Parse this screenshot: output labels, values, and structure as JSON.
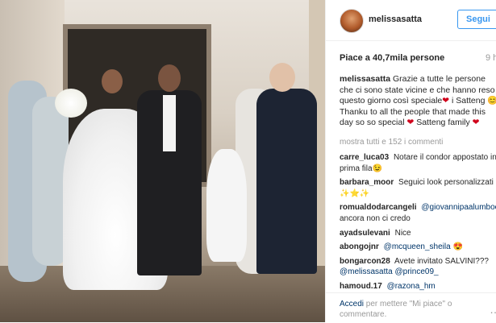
{
  "post": {
    "username": "melissasatta",
    "follow_label": "Segui",
    "likes": "Piace a 40,7mila persone",
    "time": "9 h",
    "caption_user": "melissasatta",
    "caption_text_1": "Grazie a tutte le persone che ci sono state vicine e che hanno reso questo giorno così speciale",
    "caption_text_2": "i Satteng",
    "caption_text_3": "Thanku to all the people that made this day so so special",
    "caption_text_4": "Satteng family",
    "more_comments": "mostra tutti e 152 i commenti",
    "icons": [
      "avatar-icon",
      "heart-icon",
      "smile-icon",
      "more-dots-icon"
    ],
    "accent_color": "#3897f0",
    "heart_color": "#d0021b"
  },
  "comments": [
    {
      "user": "carre_luca03",
      "text": "Notare il condor appostato in prima fila😉"
    },
    {
      "user": "barbara_moor",
      "text": "Seguici look personalizzati ✨⭐✨"
    },
    {
      "user": "romualdodarcangeli",
      "mention": "@giovannipaalumboo",
      "text": "ancora non ci credo"
    },
    {
      "user": "ayadsulevani",
      "text": "Nice"
    },
    {
      "user": "abongojnr",
      "mention": "@mcqueen_sheila",
      "text": "😍"
    },
    {
      "user": "bongarcon28",
      "text": "Avete invitato SALVINI???",
      "mention2": "@melissasatta @prince09_"
    },
    {
      "user": "hamoud.17",
      "mention": "@razona_hm",
      "text": ""
    }
  ],
  "footer": {
    "link": "Accedi",
    "text": "per mettere \"Mi piace\" o commentare."
  }
}
